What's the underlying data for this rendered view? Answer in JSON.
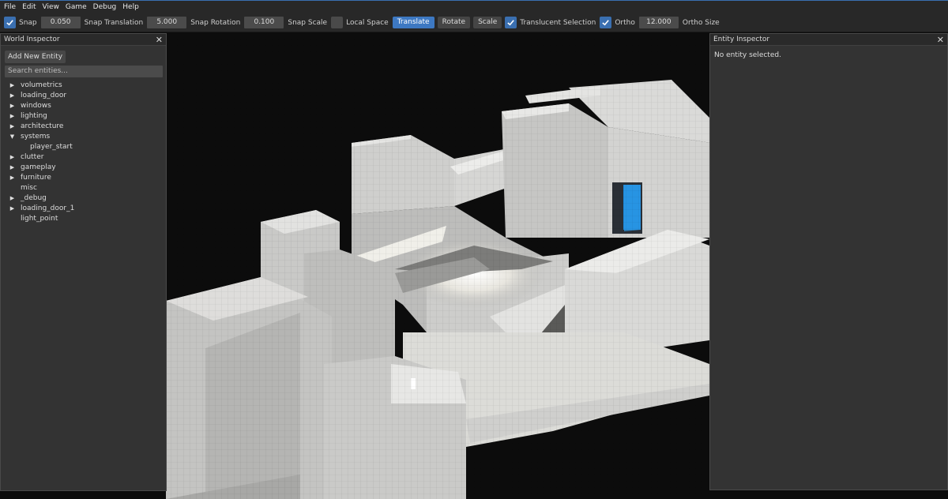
{
  "menu": [
    "File",
    "Edit",
    "View",
    "Game",
    "Debug",
    "Help"
  ],
  "toolbar": {
    "snap_label": "Snap",
    "snap_value": "0.050",
    "snap_translation_label": "Snap Translation",
    "snap_translation_value": "5.000",
    "snap_rotation_label": "Snap Rotation",
    "snap_rotation_value": "0.100",
    "snap_scale_label": "Snap Scale",
    "local_space_label": "Local Space",
    "translate_label": "Translate",
    "rotate_label": "Rotate",
    "scale_label": "Scale",
    "translucent_label": "Translucent Selection",
    "ortho_label": "Ortho",
    "ortho_size_value": "12.000",
    "ortho_size_label": "Ortho Size"
  },
  "world_inspector": {
    "title": "World Inspector",
    "close": "✕",
    "add_button": "Add New Entity",
    "search_placeholder": "Search entities...",
    "items": [
      {
        "label": "volumetrics",
        "state": "collapsed"
      },
      {
        "label": "loading_door",
        "state": "collapsed"
      },
      {
        "label": "windows",
        "state": "collapsed"
      },
      {
        "label": "lighting",
        "state": "collapsed"
      },
      {
        "label": "architecture",
        "state": "collapsed"
      },
      {
        "label": "systems",
        "state": "expanded"
      },
      {
        "label": "player_start",
        "state": "child"
      },
      {
        "label": "clutter",
        "state": "collapsed"
      },
      {
        "label": "gameplay",
        "state": "collapsed"
      },
      {
        "label": "furniture",
        "state": "collapsed"
      },
      {
        "label": "misc",
        "state": "leaf"
      },
      {
        "label": "_debug",
        "state": "collapsed"
      },
      {
        "label": "loading_door_1",
        "state": "collapsed"
      },
      {
        "label": "light_point",
        "state": "leaf"
      }
    ]
  },
  "entity_inspector": {
    "title": "Entity Inspector",
    "close": "✕",
    "empty_text": "No entity selected."
  },
  "colors": {
    "accent": "#3d78c2",
    "door_blue": "#1e88d8"
  }
}
